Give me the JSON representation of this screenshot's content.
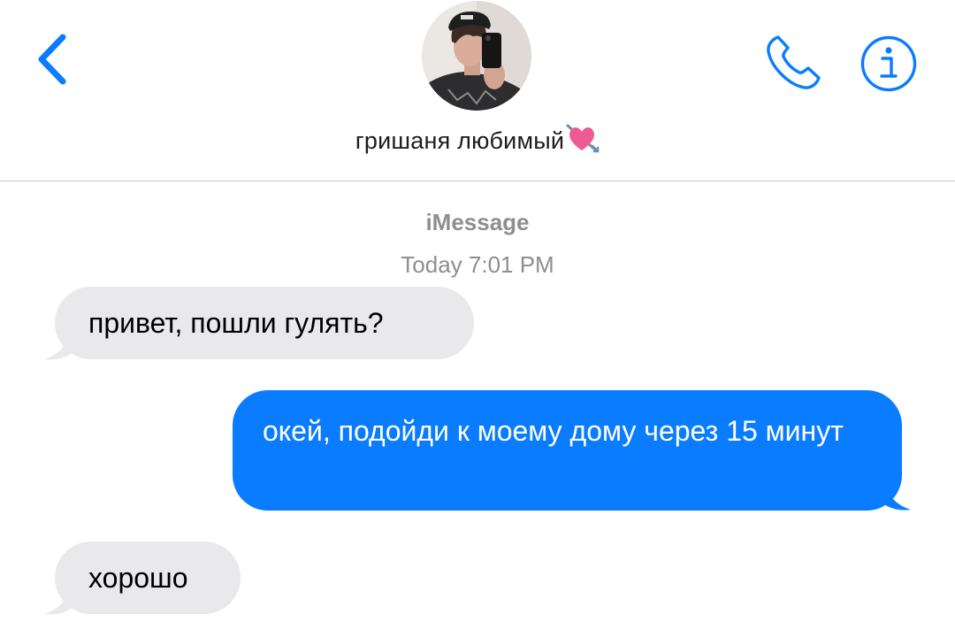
{
  "header": {
    "contact_name": "гришаня любимый",
    "back_icon": "chevron-left-icon",
    "call_icon": "phone-icon",
    "info_icon": "info-icon",
    "accent_color": "#0a7cff"
  },
  "thread": {
    "service_label": "iMessage",
    "timestamp": "Today 7:01 PM",
    "messages": [
      {
        "direction": "incoming",
        "text": "привет, пошли гулять?"
      },
      {
        "direction": "outgoing",
        "text": "окей, подойди к моему дому через 15 минут"
      },
      {
        "direction": "incoming",
        "text": "хорошо"
      }
    ]
  },
  "colors": {
    "incoming_bubble": "#e9e9eb",
    "outgoing_bubble": "#0a7cff",
    "meta_text": "#8e8e93"
  }
}
